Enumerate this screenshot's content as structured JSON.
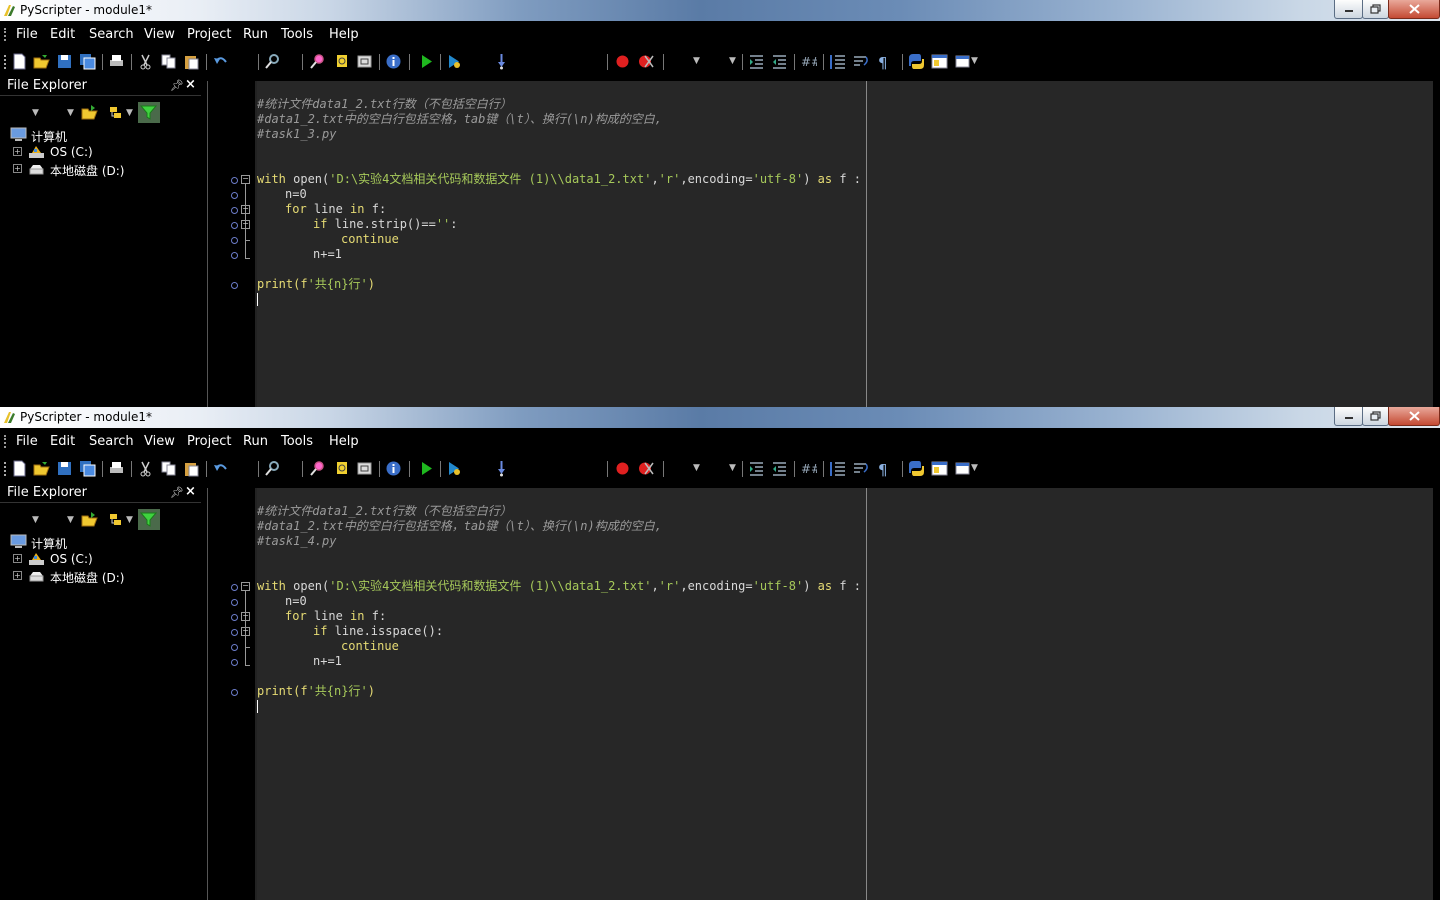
{
  "windows": [
    {
      "title": "PyScripter - module1*",
      "menu": [
        "File",
        "Edit",
        "Search",
        "View",
        "Project",
        "Run",
        "Tools",
        "Help"
      ],
      "explorer": {
        "title": "File Explorer",
        "tree": [
          {
            "label": "计算机",
            "icon": "computer-icon",
            "level": 0
          },
          {
            "label": "OS (C:)",
            "icon": "os-drive-icon",
            "level": 1
          },
          {
            "label": "本地磁盘 (D:)",
            "icon": "local-disk-icon",
            "level": 1
          }
        ]
      },
      "code": {
        "comment1": "#统计文件data1_2.txt行数（不包括空白行）",
        "comment2": "#data1_2.txt中的空白行包括空格，tab键（\\t）、换行(\\n)构成的空白,",
        "comment3": "#task1_3.py",
        "with_kw": "with",
        "open_call": " open(",
        "path_str": "'D:\\实验4文档相关代码和数据文件 (1)\\\\data1_2.txt'",
        "comma1": ",",
        "mode_str": "'r'",
        "enc_arg": ",encoding=",
        "enc_str": "'utf-8'",
        "close_paren": ")",
        "as_kw": " as",
        "as_tail": " f :",
        "n_init": "n=0",
        "for_kw": "for",
        "for_mid": " line ",
        "in_kw": "in",
        "for_tail": " f:",
        "if_kw": "if",
        "if_cond": " line.strip()==",
        "empty_str": "''",
        "colon": ":",
        "continue_kw": "continue",
        "n_inc": "n+=1",
        "print_call": "print(f",
        "print_str": "'共{n}行'",
        "print_close": ")"
      }
    },
    {
      "title": "PyScripter - module1*",
      "menu": [
        "File",
        "Edit",
        "Search",
        "View",
        "Project",
        "Run",
        "Tools",
        "Help"
      ],
      "explorer": {
        "title": "File Explorer",
        "tree": [
          {
            "label": "计算机",
            "icon": "computer-icon",
            "level": 0
          },
          {
            "label": "OS (C:)",
            "icon": "os-drive-icon",
            "level": 1
          },
          {
            "label": "本地磁盘 (D:)",
            "icon": "local-disk-icon",
            "level": 1
          }
        ]
      },
      "code": {
        "comment1": "#统计文件data1_2.txt行数（不包括空白行）",
        "comment2": "#data1_2.txt中的空白行包括空格，tab键（\\t）、换行(\\n)构成的空白,",
        "comment3": "#task1_4.py",
        "with_kw": "with",
        "open_call": " open(",
        "path_str": "'D:\\实验4文档相关代码和数据文件 (1)\\\\data1_2.txt'",
        "comma1": ",",
        "mode_str": "'r'",
        "enc_arg": ",encoding=",
        "enc_str": "'utf-8'",
        "close_paren": ")",
        "as_kw": " as",
        "as_tail": " f :",
        "n_init": "n=0",
        "for_kw": "for",
        "for_mid": " line ",
        "in_kw": "in",
        "for_tail": " f:",
        "if_kw": "if",
        "if_cond": " line.isspace():",
        "empty_str": "",
        "colon": "",
        "continue_kw": "continue",
        "n_inc": "n+=1",
        "print_call": "print(f",
        "print_str": "'共{n}行'",
        "print_close": ")"
      }
    }
  ],
  "colors": {
    "editor_bg": "#272727",
    "keyword": "#e6db74",
    "string": "#a6c95a",
    "comment": "#9a9a9a"
  }
}
